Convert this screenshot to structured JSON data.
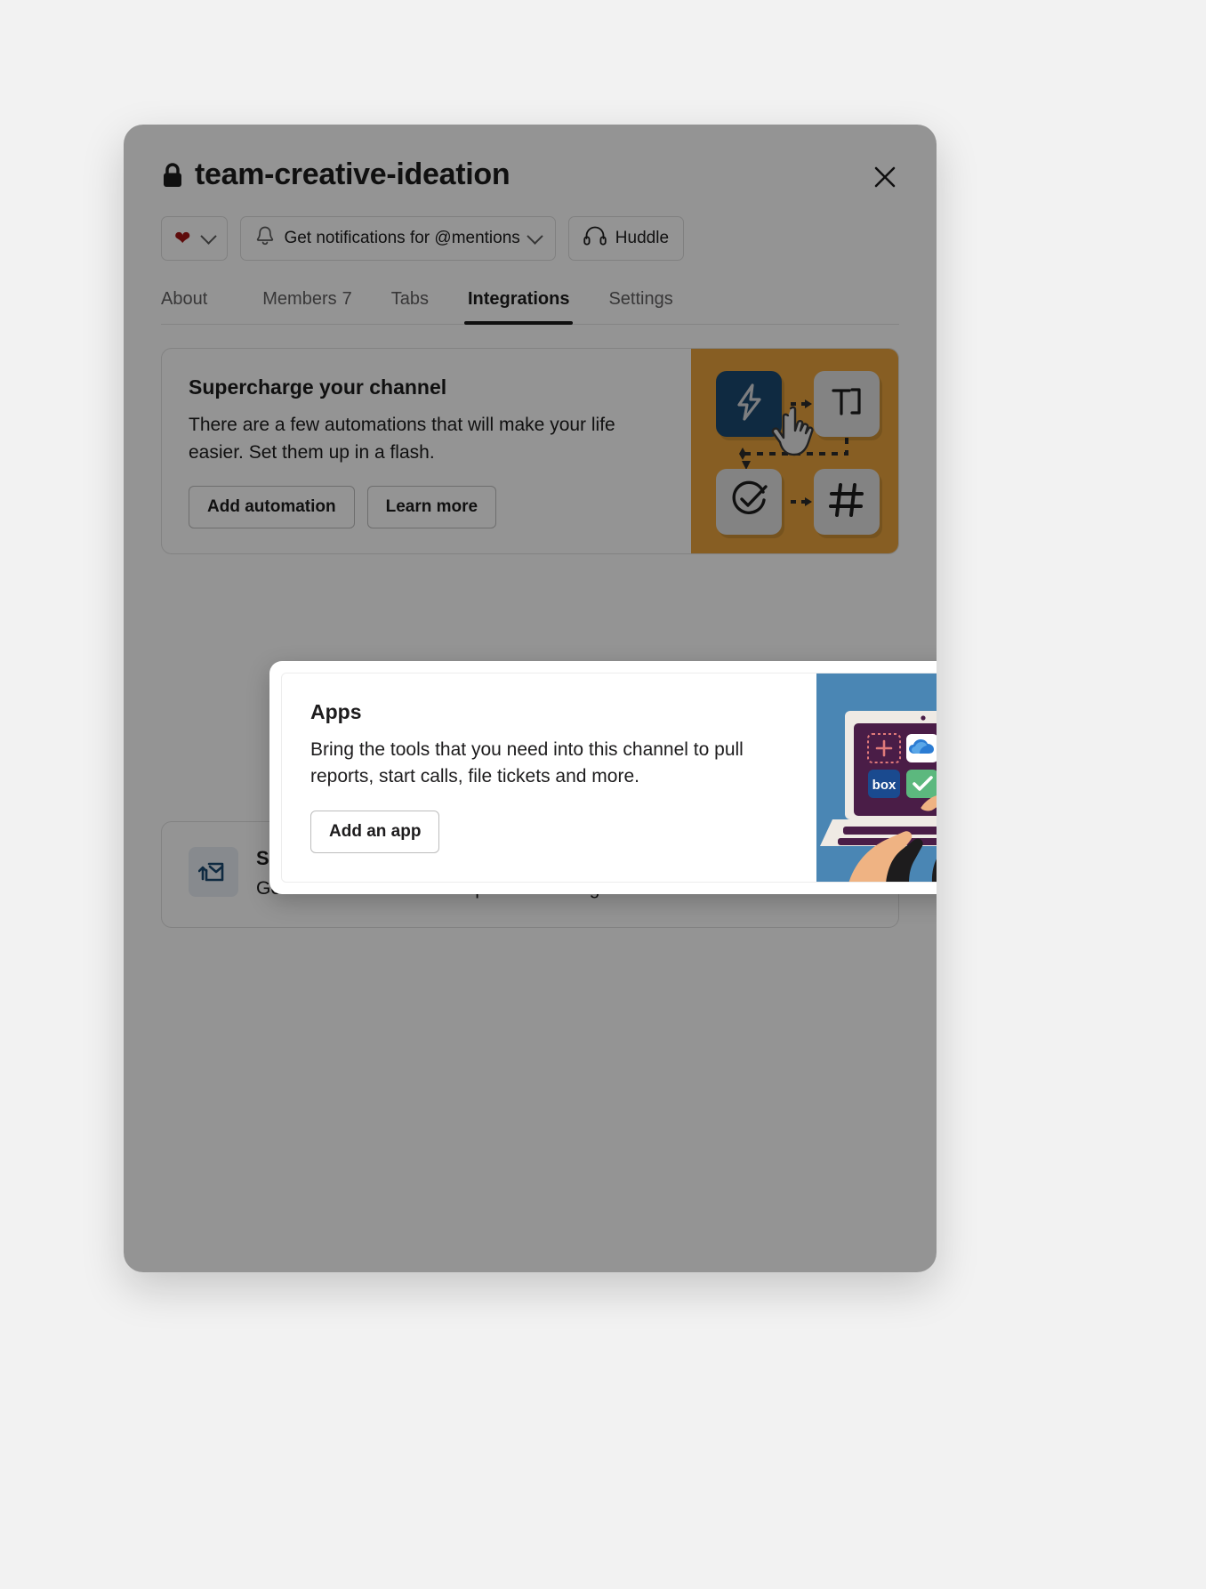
{
  "header": {
    "lock_icon": "lock-icon",
    "channel_title": "team-creative-ideation",
    "close_icon": "close-icon"
  },
  "actions": [
    {
      "id": "reaction",
      "icon": "heart-icon",
      "label": "❤",
      "chevron": "chevron-down-icon"
    },
    {
      "id": "notifications",
      "icon": "bell-icon",
      "label": "Get notifications for @mentions",
      "chevron": "chevron-down-icon"
    },
    {
      "id": "huddle",
      "icon": "headphones-icon",
      "label": "Huddle"
    }
  ],
  "tabs": [
    {
      "id": "about",
      "label": "About",
      "count": "",
      "active": false
    },
    {
      "id": "members",
      "label": "Members",
      "count": "7",
      "active": false
    },
    {
      "id": "tabs",
      "label": "Tabs",
      "count": "",
      "active": false
    },
    {
      "id": "integrations",
      "label": "Integrations",
      "count": "",
      "active": true
    },
    {
      "id": "settings",
      "label": "Settings",
      "count": "",
      "active": false
    }
  ],
  "promo": {
    "title": "Supercharge your channel",
    "description": "There are a few automations that will make your life easier. Set them up in a flash.",
    "primary_label": "Add automation",
    "secondary_label": "Learn more",
    "art": {
      "background_color": "#e8a33d",
      "tiles": [
        "bolt-icon",
        "text-field-icon",
        "check-circle-icon",
        "hash-icon"
      ],
      "cursor": "hand-cursor-icon"
    }
  },
  "apps": {
    "title": "Apps",
    "description": "Bring the tools that you need into this channel to pull reports, start calls, file tickets and more.",
    "button_label": "Add an app",
    "art": {
      "background_color": "#4a86b4",
      "screen_color": "#4a1d47",
      "icons": [
        "add-placeholder-icon",
        "onedrive-icon",
        "box-icon",
        "check-app-icon",
        "add-placeholder-icon",
        "salesforce-icon",
        "evernote-icon",
        "add-placeholder-icon"
      ]
    }
  },
  "email": {
    "icon": "email-forward-icon",
    "title": "Send emails to this channel",
    "description": "Get an email address that posts incoming emails in this channel."
  },
  "colors": {
    "accent": "#1264a3",
    "text": "#1d1c1d",
    "muted": "#616061",
    "promo_bg": "#e8a33d",
    "apps_bg": "#4a86b4",
    "page_bg": "#f2f2f2"
  }
}
